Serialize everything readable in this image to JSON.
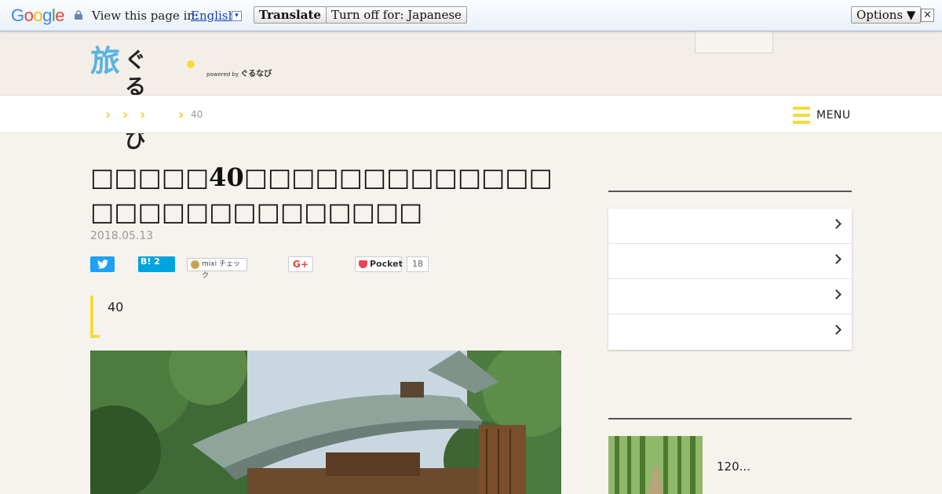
{
  "translate_bar": {
    "logo_letters": [
      "G",
      "o",
      "o",
      "g",
      "l",
      "e"
    ],
    "logo_colors": [
      "#4285f4",
      "#ea4335",
      "#fbbc05",
      "#4285f4",
      "#34a853",
      "#ea4335"
    ],
    "view_text": "View this page in:",
    "language": "English",
    "translate_label": "Translate",
    "turn_off_label": "Turn off for: Japanese",
    "options_label": "Options ▼",
    "close_glyph": "✕"
  },
  "header": {
    "logo_kanji": "旅",
    "logo_kana": "ぐるたび",
    "powered_by": "powered by",
    "powered_brand": "ぐるなび"
  },
  "nav": {
    "crumb_glyph": "›",
    "last_crumb": "40",
    "menu_label": "MENU"
  },
  "article": {
    "title": "□□□□□40□□□□□□□□□□□□□□□□□□□□□□□□□□□",
    "date": "2018.05.13",
    "lead": "40"
  },
  "share": {
    "hatena": "B! 2",
    "mixi": "mixi チェック",
    "gplus": "G+",
    "pocket": "Pocket",
    "pocket_count": "18"
  },
  "sidebar": {
    "list_items": 4,
    "related_text": "120..."
  },
  "colors": {
    "accent_yellow": "#f5dc3c",
    "twitter": "#1da1f2",
    "hatena": "#00a4de",
    "pocket": "#ef4056"
  }
}
